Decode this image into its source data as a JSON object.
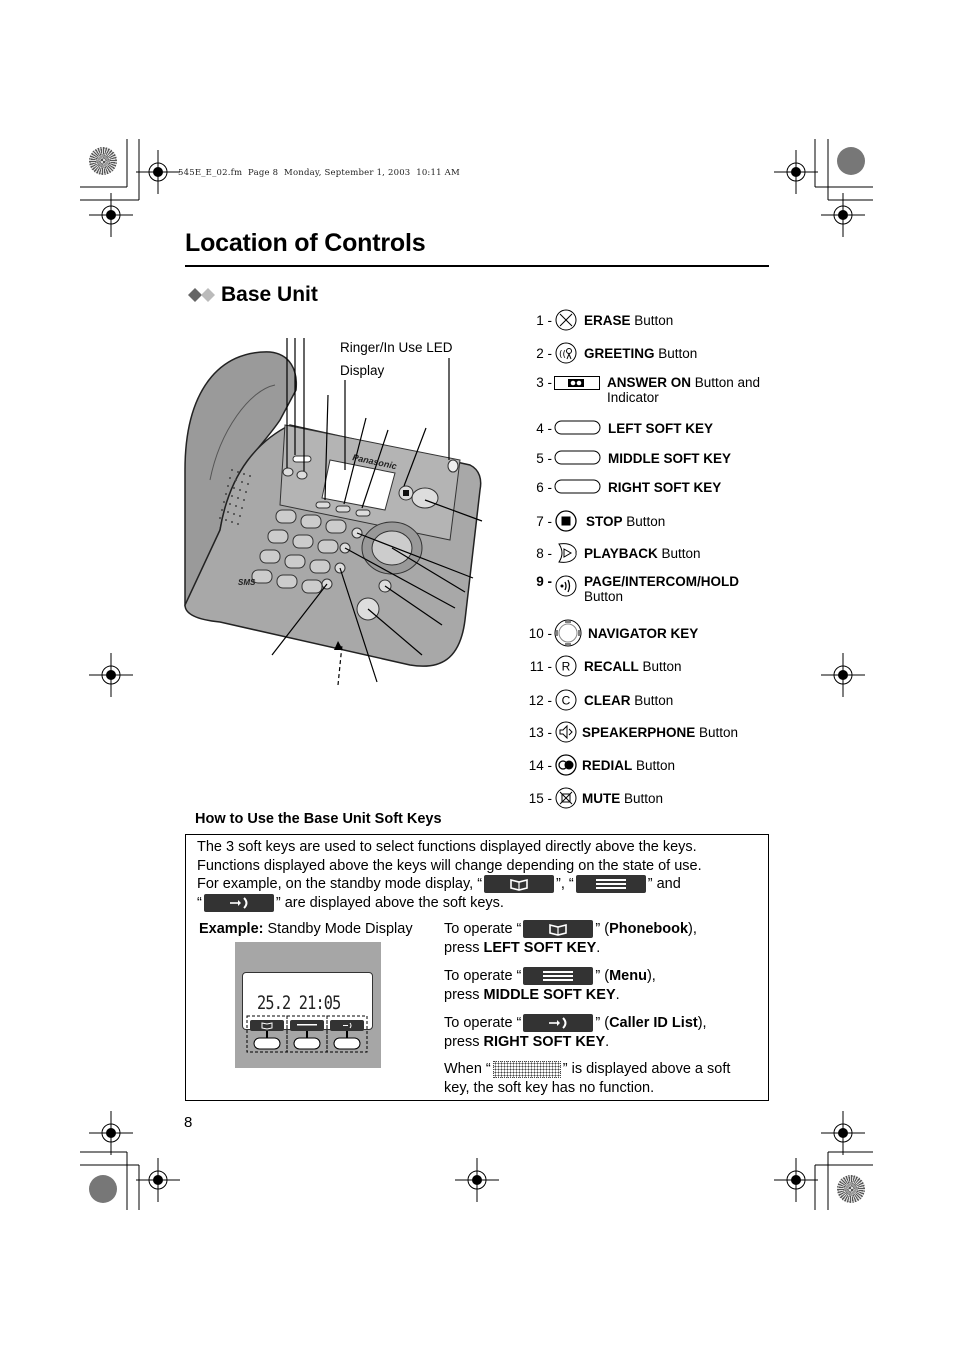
{
  "header": {
    "file_line": "545E_E_02.fm  Page 8  Monday, September 1, 2003  10:11 AM"
  },
  "page": {
    "title": "Location of Controls",
    "section_title": "Base Unit",
    "page_number": "8"
  },
  "illustration": {
    "callout_ringer": "Ringer/In Use LED",
    "callout_display": "Display",
    "brand_text": "Panasonic",
    "sms_text": "SMS"
  },
  "controls": [
    {
      "num": "1 -",
      "icon": "erase-icon",
      "bold": "ERASE",
      "rest": " Button"
    },
    {
      "num": "2 -",
      "icon": "greeting-icon",
      "bold": "GREETING",
      "rest": " Button"
    },
    {
      "num": "3 -",
      "icon": "answer-on-icon",
      "bold": "ANSWER ON",
      "rest": " Button and Indicator"
    },
    {
      "num": "4 -",
      "icon": "soft-key-icon",
      "bold": "LEFT SOFT KEY",
      "rest": ""
    },
    {
      "num": "5 -",
      "icon": "soft-key-icon",
      "bold": "MIDDLE SOFT KEY",
      "rest": ""
    },
    {
      "num": "6 -",
      "icon": "soft-key-icon",
      "bold": "RIGHT SOFT KEY",
      "rest": ""
    },
    {
      "num": "7 -",
      "icon": "stop-icon",
      "bold": "STOP",
      "rest": " Button"
    },
    {
      "num": "8 -",
      "icon": "playback-icon",
      "bold": "PLAYBACK",
      "rest": " Button"
    },
    {
      "num": "9 -",
      "icon": "page-intercom-hold-icon",
      "bold": "PAGE/INTERCOM/HOLD",
      "rest": "Button"
    },
    {
      "num": "10 -",
      "icon": "navigator-key-icon",
      "bold": "NAVIGATOR KEY",
      "rest": ""
    },
    {
      "num": "11 -",
      "icon": "recall-icon",
      "bold": "RECALL",
      "rest": " Button"
    },
    {
      "num": "12 -",
      "icon": "clear-icon",
      "bold": "CLEAR",
      "rest": " Button"
    },
    {
      "num": "13 -",
      "icon": "speakerphone-icon",
      "bold": "SPEAKERPHONE",
      "rest": " Button"
    },
    {
      "num": "14 -",
      "icon": "redial-icon",
      "bold": "REDIAL",
      "rest": " Button"
    },
    {
      "num": "15 -",
      "icon": "mute-icon",
      "bold": "MUTE",
      "rest": " Button"
    }
  ],
  "soft_keys": {
    "heading": "How to Use the Base Unit Soft Keys",
    "intro_1": "The 3 soft keys are used to select functions displayed directly above the keys.",
    "intro_2": "Functions displayed above the keys will change depending on the state of use.",
    "intro_3a": "For example, on the standby mode display, “",
    "intro_3b": "”, “",
    "intro_3c": "” and",
    "intro_4a": "“",
    "intro_4b": "” are displayed above the soft keys.",
    "example_bold": "Example:",
    "example_rest": " Standby Mode Display",
    "lcd_time": "25.2 21:05",
    "ops": [
      {
        "pre": "To operate “",
        "mid": "” (",
        "name": "Phonebook",
        "post": "),",
        "press": "press ",
        "key": "LEFT SOFT KEY",
        "end": ".",
        "icon": "phonebook-icon"
      },
      {
        "pre": "To operate “",
        "mid": "” (",
        "name": "Menu",
        "post": "),",
        "press": "press ",
        "key": "MIDDLE SOFT KEY",
        "end": ".",
        "icon": "menu-icon"
      },
      {
        "pre": "To operate “",
        "mid": "” (",
        "name": "Caller ID List",
        "post": "),",
        "press": "press ",
        "key": "RIGHT SOFT KEY",
        "end": ".",
        "icon": "caller-id-icon"
      }
    ],
    "nofunc_a": "When “",
    "nofunc_b": "” is displayed above a soft",
    "nofunc_c": "key, the soft key has no function."
  }
}
